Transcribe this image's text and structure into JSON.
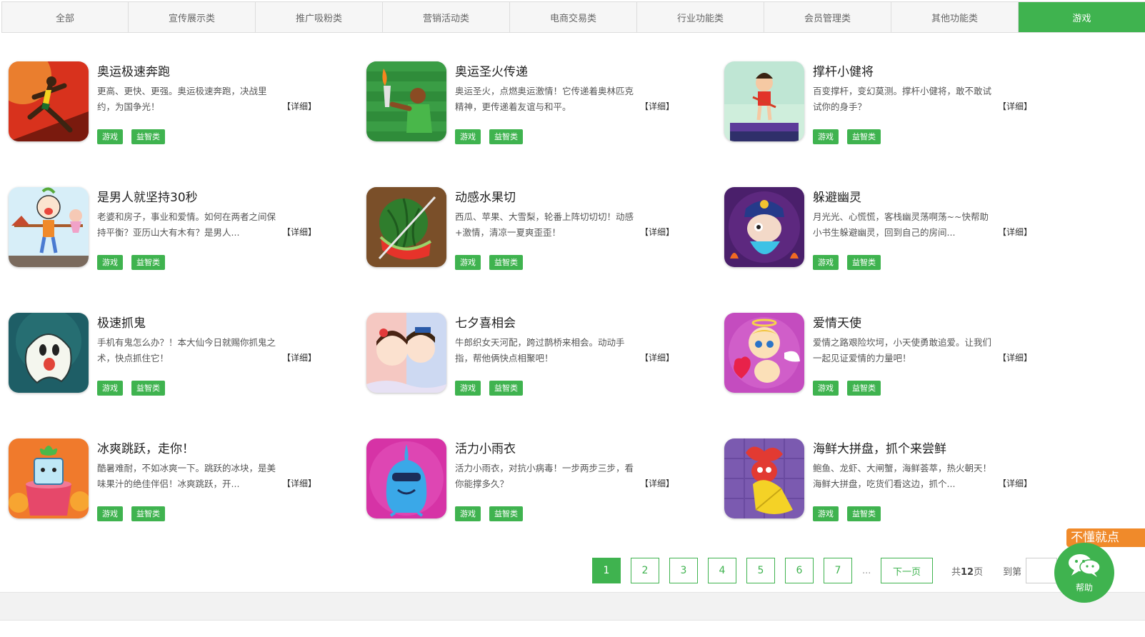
{
  "tabs": [
    {
      "label": "全部"
    },
    {
      "label": "宣传展示类"
    },
    {
      "label": "推广吸粉类"
    },
    {
      "label": "营销活动类"
    },
    {
      "label": "电商交易类"
    },
    {
      "label": "行业功能类"
    },
    {
      "label": "会员管理类"
    },
    {
      "label": "其他功能类"
    },
    {
      "label": "游戏"
    }
  ],
  "active_tab": "游戏",
  "detail_label": "【详细】",
  "tag_labels": [
    "游戏",
    "益智类"
  ],
  "games": [
    {
      "title": "奥运极速奔跑",
      "desc": "更高、更快、更强。奥运极速奔跑，决战里约，为国争光！",
      "icon": "sprinter-icon"
    },
    {
      "title": "奥运圣火传递",
      "desc": "奥运圣火，点燃奥运激情！它传递着奥林匹克精神，更传递着友谊与和平。",
      "icon": "torch-icon"
    },
    {
      "title": "撑杆小健将",
      "desc": "百变撑杆，变幻莫测。撑杆小健将，敢不敢试试你的身手？",
      "icon": "pole-vault-icon"
    },
    {
      "title": "是男人就坚持30秒",
      "desc": "老婆和房子，事业和爱情。如何在两者之间保持平衡？亚历山大有木有？是男人...",
      "icon": "balance-man-icon"
    },
    {
      "title": "动感水果切",
      "desc": "西瓜、苹果、大雪梨，轮番上阵切切切！动感+激情，清凉一夏爽歪歪！",
      "icon": "watermelon-icon"
    },
    {
      "title": "躲避幽灵",
      "desc": "月光光、心慌慌，客栈幽灵荡啊荡~~快帮助小书生躲避幽灵，回到自己的房间...",
      "icon": "jiangshi-ghost-icon"
    },
    {
      "title": "极速抓鬼",
      "desc": "手机有鬼怎么办？！本大仙今日就赐你抓鬼之术，快点抓住它！",
      "icon": "white-ghost-icon"
    },
    {
      "title": "七夕喜相会",
      "desc": "牛郎织女天河配，跨过鹊桥来相会。动动手指，帮他俩快点相聚吧！",
      "icon": "couple-icon"
    },
    {
      "title": "爱情天使",
      "desc": "爱情之路艰险坎坷，小天使勇敢追爱。让我们一起见证爱情的力量吧！",
      "icon": "cupid-icon"
    },
    {
      "title": "冰爽跳跃，走你！",
      "desc": "酷暑难耐，不如冰爽一下。跳跃的冰块，是美味果汁的绝佳伴侣！冰爽跳跃，开...",
      "icon": "ice-cube-icon"
    },
    {
      "title": "活力小雨衣",
      "desc": "活力小雨衣，对抗小病毒！一步两步三步，看你能撑多久？",
      "icon": "raincoat-icon"
    },
    {
      "title": "海鲜大拼盘，抓个来尝鲜",
      "desc": "鲍鱼、龙虾、大闸蟹，海鲜荟萃，热火朝天！海鲜大拼盘，吃货们看这边，抓个...",
      "icon": "lobster-icon"
    }
  ],
  "pagination": {
    "current": "1",
    "pages": [
      "1",
      "2",
      "3",
      "4",
      "5",
      "6",
      "7"
    ],
    "ellipsis": "...",
    "next_label": "下一页",
    "total_prefix": "共",
    "total_pages": "12",
    "total_suffix": "页",
    "goto_label": "到第"
  },
  "help_widget": {
    "banner": "不懂就点",
    "label": "帮助",
    "icon": "wechat-icon"
  },
  "colors": {
    "accent": "#3fb34f",
    "help_orange": "#f08a2a"
  }
}
